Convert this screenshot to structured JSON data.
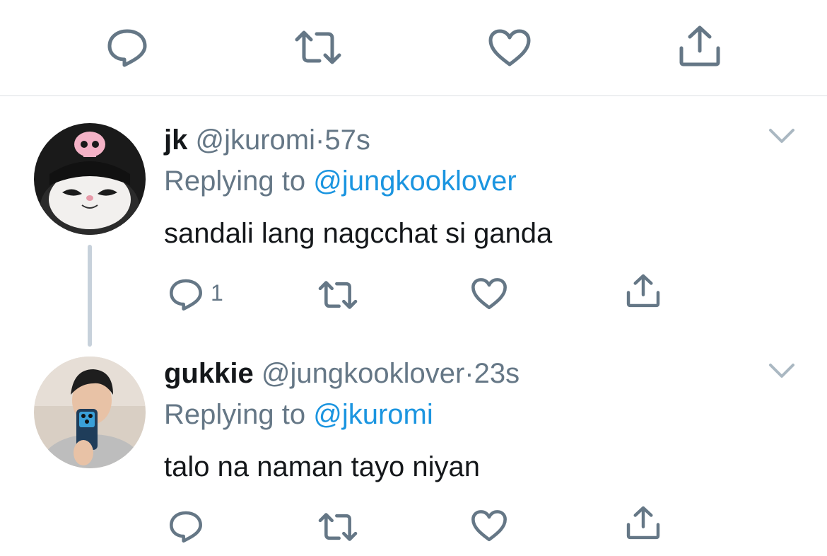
{
  "top_actions": {
    "icons": [
      "reply-icon",
      "retweet-icon",
      "like-icon",
      "share-icon"
    ]
  },
  "tweets": [
    {
      "name": "jk",
      "handle": "@jkuromi",
      "separator": "·",
      "time": "57s",
      "replying_prefix": "Replying to ",
      "replying_to": "@jungkooklover",
      "text": "sandali lang nagcchat si ganda",
      "reply_count": "1"
    },
    {
      "name": "gukkie",
      "handle": "@jungkooklover",
      "separator": "·",
      "time": "23s",
      "replying_prefix": "Replying to ",
      "replying_to": "@jkuromi",
      "text": "talo na naman tayo niyan",
      "reply_count": ""
    }
  ],
  "colors": {
    "icon": "#657786",
    "link": "#1b95e0",
    "text": "#14171a",
    "divider": "#dcdfe3",
    "thread_line": "#c7d1db"
  }
}
